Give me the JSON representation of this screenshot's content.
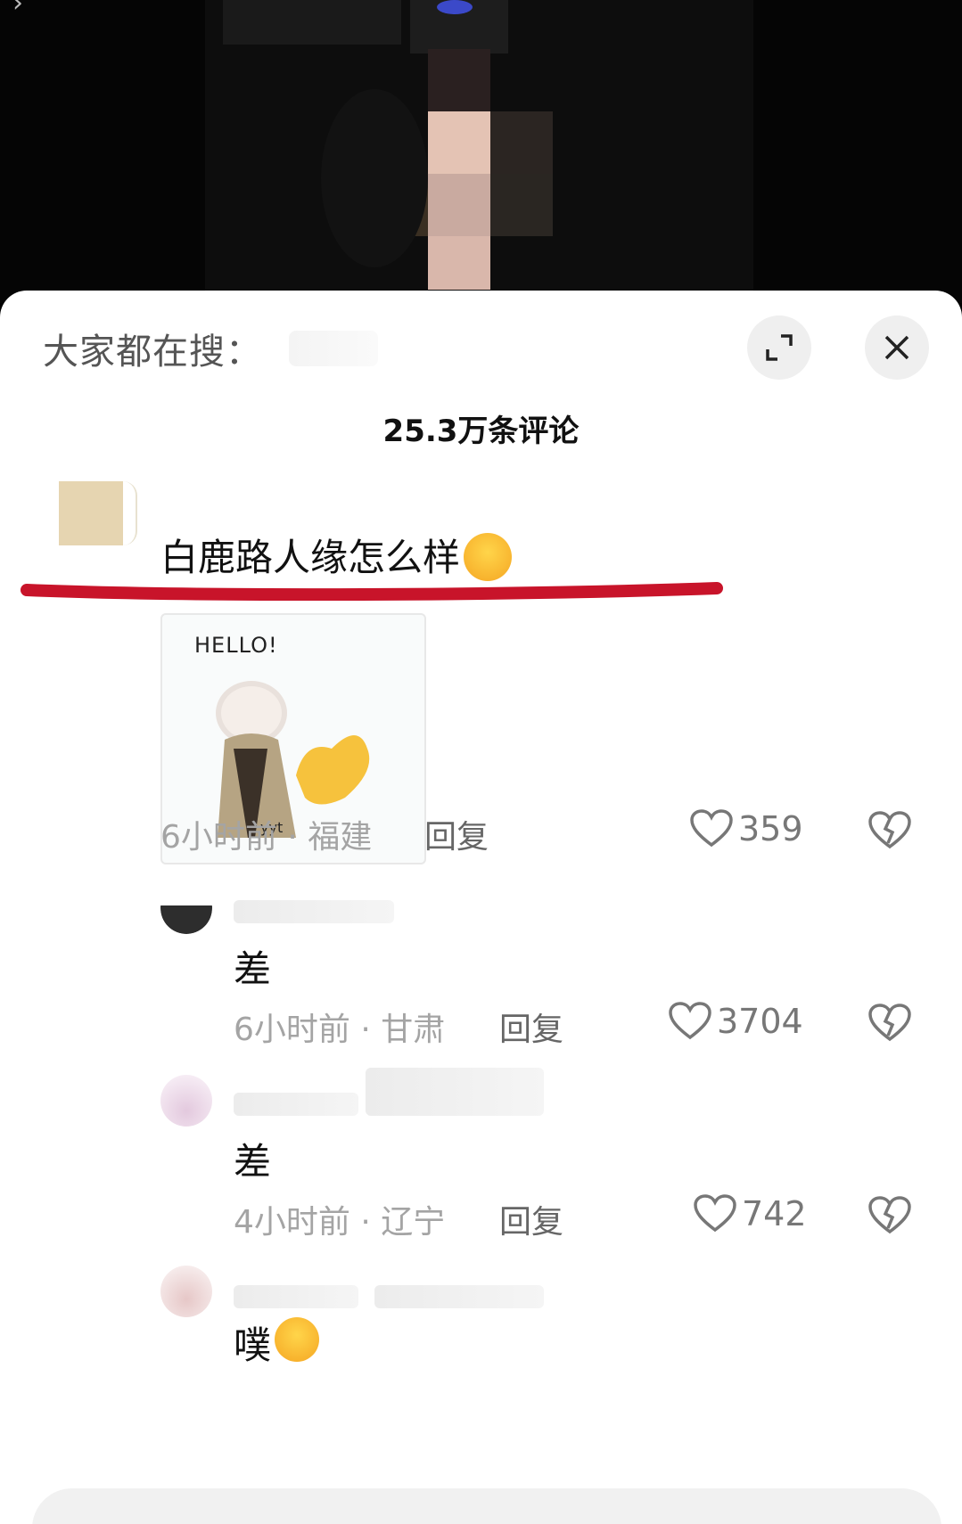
{
  "header": {
    "search_label": "大家都在搜：",
    "comment_count": "25.3万条评论"
  },
  "comment": {
    "text": "白鹿路人缘怎么样",
    "sticker_caption": "HELLO!",
    "time_location": "6小时前 · 福建",
    "reply_label": "回复",
    "likes": "359"
  },
  "replies": [
    {
      "text": "差",
      "time_location": "6小时前 · 甘肃",
      "reply_label": "回复",
      "likes": "3704"
    },
    {
      "text": "差",
      "time_location": "4小时前 · 辽宁",
      "reply_label": "回复",
      "likes": "742"
    },
    {
      "text": "噗"
    }
  ],
  "colors": {
    "highlight_underline": "#c8142a",
    "sheet_background": "#ffffff",
    "video_background": "#050505"
  },
  "icons": {
    "expand": "expand-icon",
    "close": "close-icon",
    "like": "heart-icon",
    "dislike": "broken-heart-icon",
    "emoji": "emoji-icon"
  }
}
